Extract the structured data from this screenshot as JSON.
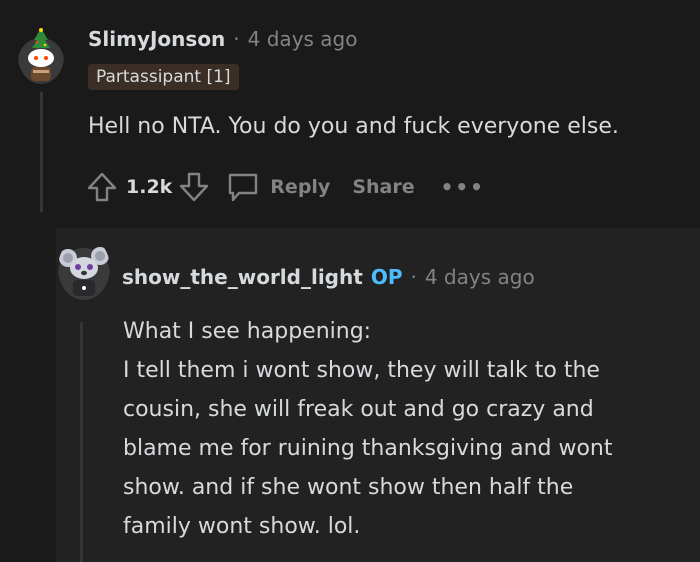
{
  "comment": {
    "username": "SlimyJonson",
    "separator": "·",
    "time": "4 days ago",
    "flair": "Partassipant [1]",
    "body": "Hell no NTA. You do you and fuck everyone else.",
    "votes": "1.2k",
    "reply_label": "Reply",
    "share_label": "Share",
    "more_label": "•••"
  },
  "reply": {
    "username": "show_the_world_light",
    "op_badge": "OP",
    "separator": "·",
    "time": "4 days ago",
    "body_lines": [
      "What I see happening:",
      "I tell them i wont show, they will talk to the",
      "cousin, she will freak out and go crazy and",
      "blame me for ruining thanksgiving and wont",
      "show. and if she wont show then half the",
      "family wont show. lol."
    ]
  },
  "colors": {
    "background": "#1a1a1b",
    "text": "#d7dadc",
    "muted": "#818384",
    "op": "#4fbcff",
    "flair_bg": "#3b2e27"
  }
}
